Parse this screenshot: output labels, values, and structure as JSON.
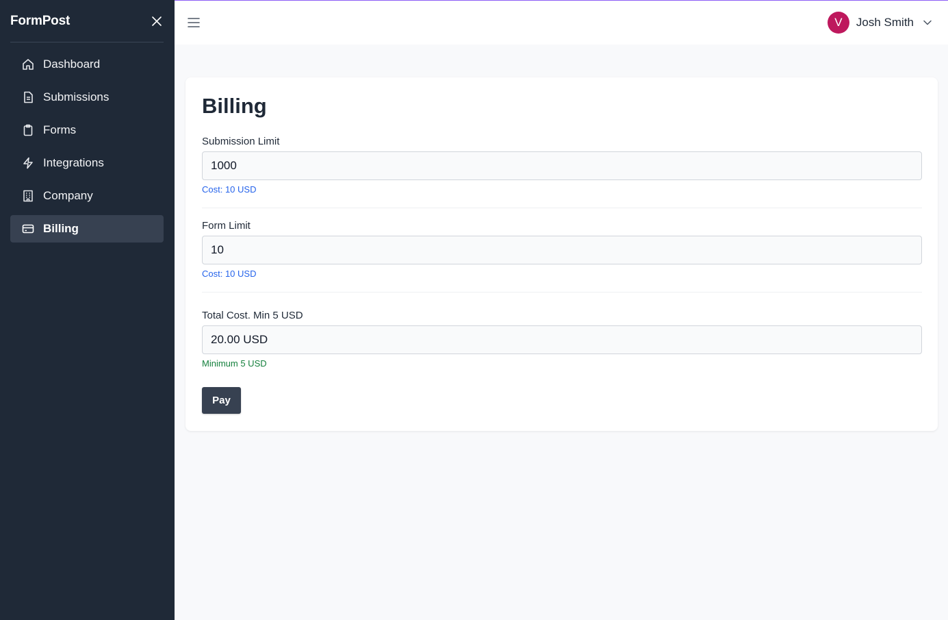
{
  "app": {
    "name": "FormPost"
  },
  "sidebar": {
    "items": [
      {
        "label": "Dashboard",
        "icon": "home-icon"
      },
      {
        "label": "Submissions",
        "icon": "document-icon"
      },
      {
        "label": "Forms",
        "icon": "clipboard-icon"
      },
      {
        "label": "Integrations",
        "icon": "lightning-icon"
      },
      {
        "label": "Company",
        "icon": "building-icon"
      },
      {
        "label": "Billing",
        "icon": "credit-card-icon",
        "active": true
      }
    ]
  },
  "header": {
    "user": {
      "initial": "V",
      "name": "Josh Smith",
      "avatar_color": "#be185d"
    }
  },
  "billing": {
    "title": "Billing",
    "submission_limit": {
      "label": "Submission Limit",
      "value": "1000",
      "hint": "Cost: 10 USD"
    },
    "form_limit": {
      "label": "Form Limit",
      "value": "10",
      "hint": "Cost: 10 USD"
    },
    "total_cost": {
      "label": "Total Cost. Min 5 USD",
      "value": "20.00 USD",
      "hint": "Minimum 5 USD"
    },
    "pay_label": "Pay"
  },
  "colors": {
    "sidebar_bg": "#1f2937",
    "active_item_bg": "#374151",
    "link_blue": "#2563eb",
    "success_green": "#15803d"
  }
}
